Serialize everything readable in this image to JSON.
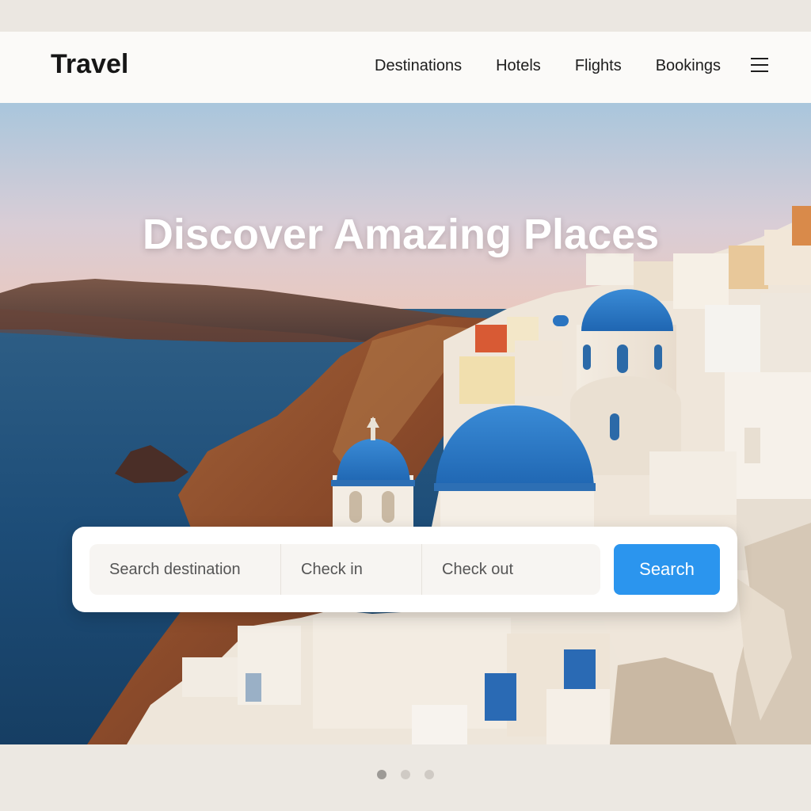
{
  "header": {
    "brand": "Travel",
    "nav": [
      {
        "label": "Destinations"
      },
      {
        "label": "Hotels"
      },
      {
        "label": "Flights"
      },
      {
        "label": "Bookings"
      }
    ],
    "menu_icon": "hamburger-menu-icon"
  },
  "hero": {
    "title": "Discover Amazing Places",
    "image": "santorini-blue-domes-photo"
  },
  "search": {
    "destination_placeholder": "Search destination",
    "checkin_placeholder": "Check in",
    "checkout_placeholder": "Check out",
    "button_label": "Search"
  },
  "carousel": {
    "slide_count": 3,
    "active_index": 0
  },
  "colors": {
    "accent": "#2b95ee",
    "dome_blue": "#2a74c0",
    "page_bg": "#ece8e2"
  }
}
